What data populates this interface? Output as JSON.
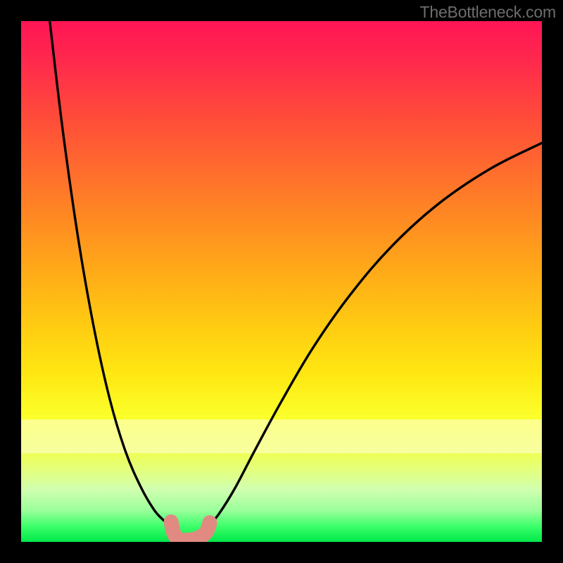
{
  "watermark": "TheBottleneck.com",
  "chart_data": {
    "type": "line",
    "title": "",
    "xlabel": "",
    "ylabel": "",
    "xlim": [
      0,
      100
    ],
    "ylim": [
      0,
      100
    ],
    "grid": false,
    "series": [
      {
        "name": "left-arm",
        "x": [
          5.5,
          8,
          11,
          14,
          17,
          20,
          23,
          25.5,
          27.3,
          28.7,
          30
        ],
        "y": [
          100,
          79,
          58,
          41,
          27.5,
          17.5,
          10.5,
          6.2,
          4.2,
          3.0,
          2.2
        ]
      },
      {
        "name": "right-arm",
        "x": [
          36,
          38,
          41,
          45,
          50,
          56,
          63,
          71,
          80,
          90,
          100
        ],
        "y": [
          3.0,
          5.4,
          10.2,
          17.8,
          27.0,
          37.2,
          47.2,
          56.6,
          64.8,
          71.6,
          76.6
        ]
      },
      {
        "name": "marker-outline",
        "x": [
          28.8,
          29.0,
          29.2,
          29.5,
          29.9,
          30.5,
          31.2,
          32.0,
          32.9,
          33.9,
          34.9,
          35.4,
          35.7,
          35.9,
          36.1,
          36.2
        ],
        "y": [
          3.85,
          2.85,
          1.95,
          1.25,
          0.75,
          0.45,
          0.35,
          0.35,
          0.45,
          0.75,
          1.25,
          1.7,
          2.15,
          2.65,
          3.15,
          3.7
        ]
      }
    ],
    "marker": {
      "color": "#e18a82",
      "stroke_width": 21
    },
    "curve_style": {
      "color": "#000000",
      "stroke_width": 3.4
    }
  }
}
